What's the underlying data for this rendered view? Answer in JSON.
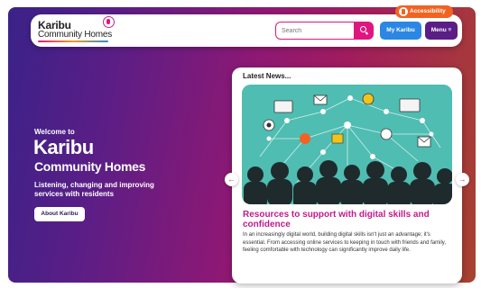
{
  "header": {
    "logo_line1": "Karibu",
    "logo_line2": "Community Homes",
    "search_placeholder": "Search",
    "my_karibu_label": "My Karibu",
    "menu_label": "Menu ≡",
    "accessibility_label": "Accessibility"
  },
  "hero": {
    "welcome": "Welcome to",
    "title_line1": "Karibu",
    "title_line2": "Community Homes",
    "tagline": "Listening, changing and improving services with residents",
    "about_button": "About Karibu"
  },
  "news": {
    "heading": "Latest News...",
    "article_title": "Resources to support with digital skills and confidence",
    "article_body": "In an increasingly digital world, building digital skills isn't just an advantage; it's essential. From accessing online services to keeping in touch with friends and family, feeling comfortable with technology can significantly improve daily life.",
    "prev_arrow": "←",
    "next_arrow": "→"
  },
  "colors": {
    "brand_pink": "#e0167f",
    "brand_purple": "#5a1e86",
    "button_blue": "#2b87e3",
    "accessibility_orange": "#f26322",
    "news_title": "#c21a8a",
    "image_teal": "#4fbdb2"
  }
}
